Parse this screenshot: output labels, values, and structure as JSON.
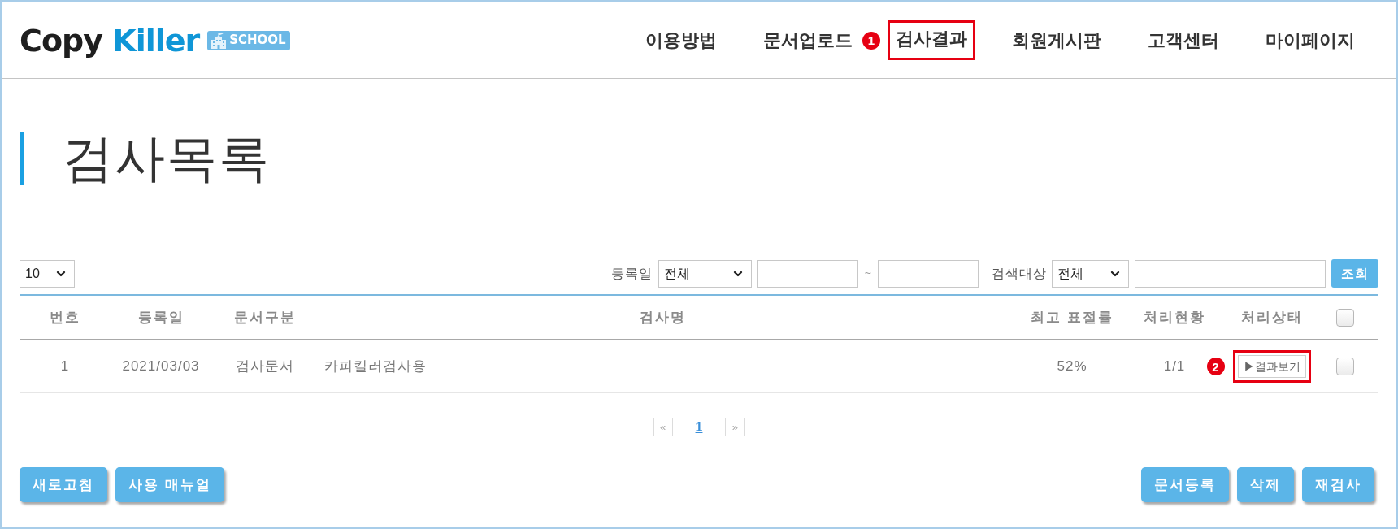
{
  "header": {
    "logo": {
      "word_1": "Copy",
      "word_2": "Killer",
      "badge": "SCHOOL"
    },
    "nav": [
      {
        "label": "이용방법",
        "highlighted": false
      },
      {
        "label": "문서업로드",
        "highlighted": false
      },
      {
        "label": "검사결과",
        "highlighted": true,
        "marker": "1"
      },
      {
        "label": "회원게시판",
        "highlighted": false
      },
      {
        "label": "고객센터",
        "highlighted": false
      },
      {
        "label": "마이페이지",
        "highlighted": false
      }
    ]
  },
  "page_title": "검사목록",
  "filters": {
    "page_size": "10",
    "date_label": "등록일",
    "date_range": "전체",
    "range_separator": "~",
    "search_label": "검색대상",
    "search_target": "전체",
    "search_button": "조회"
  },
  "table": {
    "columns": [
      "번호",
      "등록일",
      "문서구분",
      "검사명",
      "최고 표절률",
      "처리현황",
      "처리상태"
    ],
    "select_all_checked": false,
    "rows": [
      {
        "number": "1",
        "date": "2021/03/03",
        "category": "검사문서",
        "name": "카피킬러검사용",
        "max_rate": "52%",
        "progress": "1/1",
        "status_button": "▶결과보기",
        "status_highlighted": true,
        "marker": "2",
        "checked": false
      }
    ]
  },
  "pagination": {
    "prev": "«",
    "next": "»",
    "pages": [
      {
        "label": "1",
        "selected": true
      }
    ]
  },
  "left_buttons": [
    "새로고침",
    "사용 매뉴얼"
  ],
  "right_buttons": [
    "문서등록",
    "삭제",
    "재검사"
  ]
}
